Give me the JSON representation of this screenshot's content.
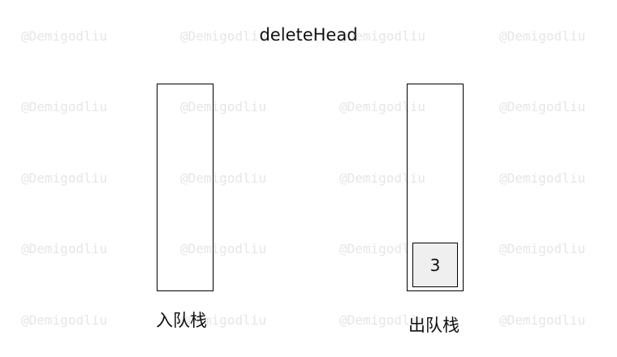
{
  "watermark": "@Demigodliu",
  "title": "deleteHead",
  "in_stack": {
    "label": "入队栈",
    "elements": []
  },
  "out_stack": {
    "label": "出队栈",
    "elements": [
      "3"
    ]
  }
}
